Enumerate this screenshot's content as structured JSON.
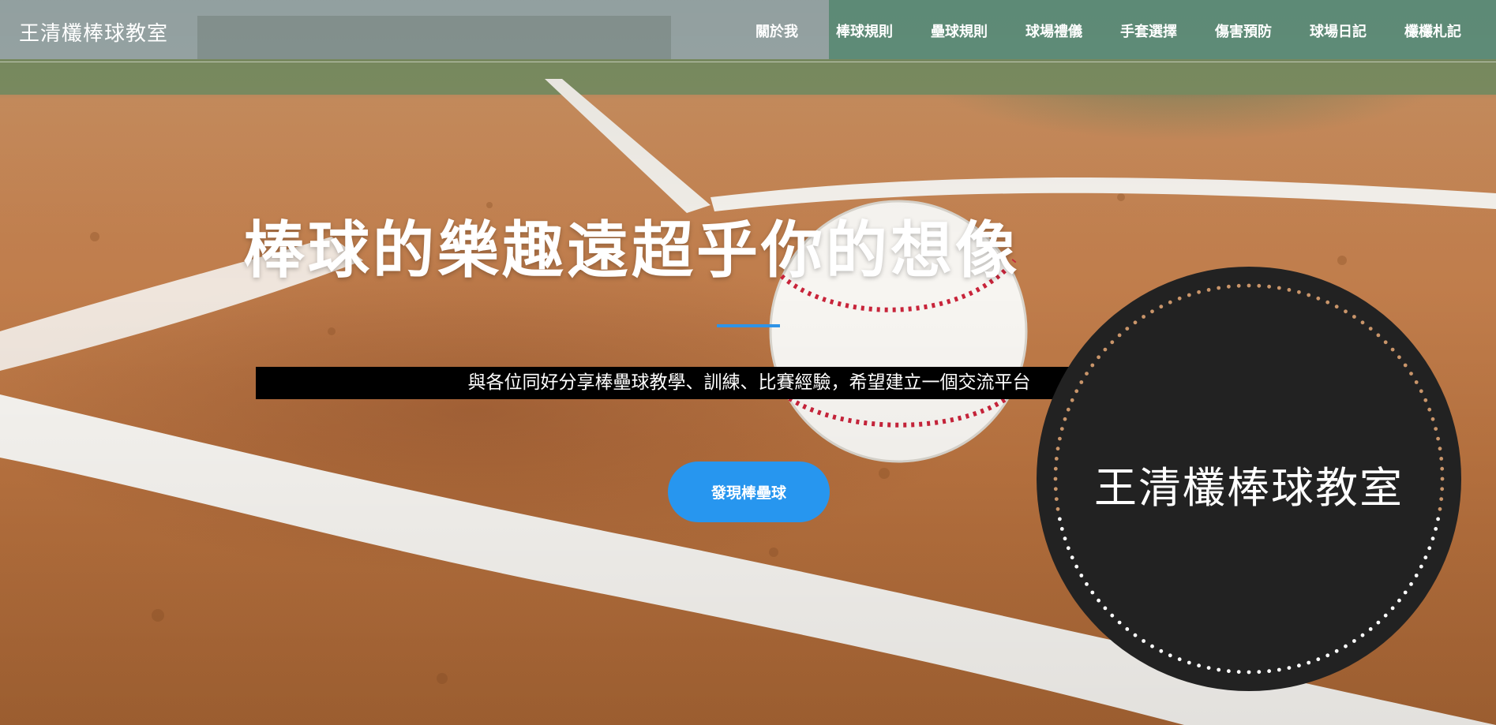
{
  "brand": "王清欉棒球教室",
  "nav": [
    "關於我",
    "棒球規則",
    "壘球規則",
    "球場禮儀",
    "手套選擇",
    "傷害預防",
    "球場日記",
    "欉欉札記"
  ],
  "hero": {
    "headline": "棒球的樂趣遠超乎你的想像",
    "subtitle": "與各位同好分享棒壘球教學、訓練、比賽經驗，希望建立一個交流平台",
    "cta": "發現棒壘球"
  },
  "badge": {
    "title": "王清欉棒球教室"
  },
  "colors": {
    "accent": "#2796ef",
    "badge_bg": "#222222",
    "dots_top": "#c9956a",
    "dots_bottom": "#ffffff"
  }
}
